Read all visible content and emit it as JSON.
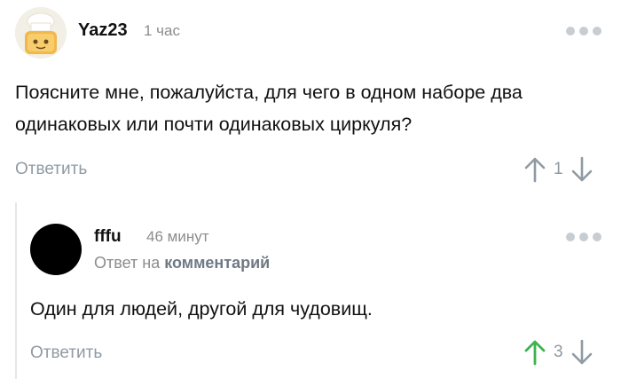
{
  "comment": {
    "author": "Yaz23",
    "time": "1 час",
    "text": "Поясните мне, пожалуйста, для чего в одном наборе два одинаковых или почти одинаковых циркуля?",
    "reply_label": "Ответить",
    "score": "1",
    "more_icon": "more-dots-icon"
  },
  "reply": {
    "author": "fffu",
    "time": "46 минут",
    "meta_prefix": "Ответ на",
    "meta_link": "комментарий",
    "text": "Один для людей, другой для чудовищ.",
    "reply_label": "Ответить",
    "score": "3",
    "upvote_active_color": "#3fb34f"
  },
  "colors": {
    "muted": "#8f9aa3",
    "dots": "#c8cdd2",
    "upvote_active": "#3fb34f"
  }
}
